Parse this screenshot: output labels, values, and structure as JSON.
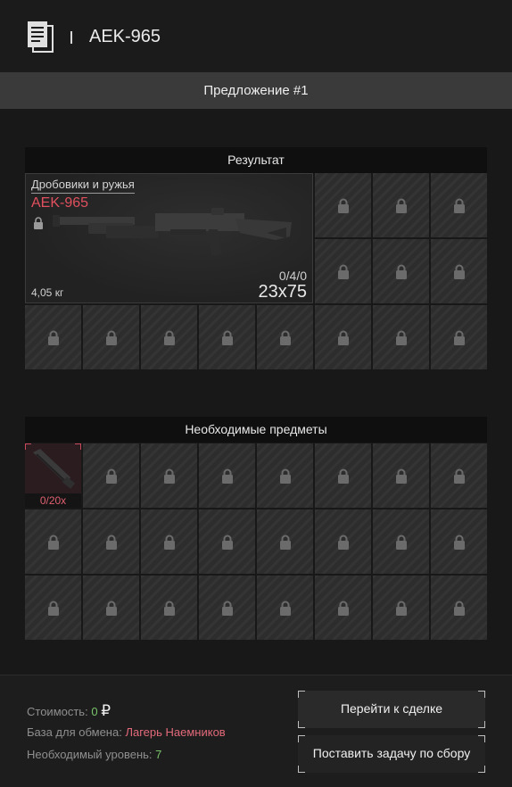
{
  "header": {
    "title": "AEK-965",
    "icon": "document-icon"
  },
  "offer": {
    "label": "Предложение #1"
  },
  "result": {
    "section_title": "Результат",
    "category": "Дробовики и ружья",
    "item_name": "AEK-965",
    "durability": "0/4/0",
    "caliber": "23x75",
    "weight": "4,05 кг",
    "locked_slot_count": 14
  },
  "required": {
    "section_title": "Необходимые предметы",
    "item": {
      "count": "0/20x",
      "icon": "barrel-icon"
    },
    "locked_slot_count": 23
  },
  "footer": {
    "cost_label": "Стоимость:",
    "cost_value": "0",
    "currency": "₽",
    "base_label": "База для обмена:",
    "base_value": "Лагерь Наемников",
    "level_label": "Необходимый уровень:",
    "level_value": "7",
    "go_to_deal_label": "Перейти к сделке",
    "set_task_label": "Поставить задачу по сбору"
  },
  "colors": {
    "accent_red": "#e0505e",
    "green": "#79c46a",
    "background": "#1c1c1c"
  }
}
